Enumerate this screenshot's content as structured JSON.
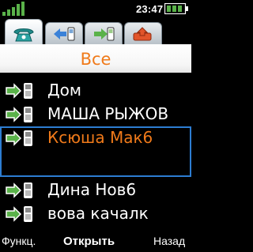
{
  "status": {
    "time": "23:47"
  },
  "tabs": [
    {
      "icon": "phone-icon",
      "active": true
    },
    {
      "icon": "arrow-left-phone-icon",
      "active": false
    },
    {
      "icon": "arrow-right-phone-icon",
      "active": false
    },
    {
      "icon": "missed-call-icon",
      "active": false
    }
  ],
  "header": {
    "title": "Все"
  },
  "contacts": [
    {
      "name": "Дом",
      "icon": "outgoing-call-icon",
      "selected": false
    },
    {
      "name": "МАША РЫЖОВ",
      "icon": "outgoing-call-icon",
      "selected": false
    },
    {
      "name": "Ксюша Мак6",
      "icon": "outgoing-call-icon",
      "selected": true
    },
    {
      "name": "Дина Нов6",
      "icon": "outgoing-call-icon",
      "selected": false
    },
    {
      "name": "вова качалк",
      "icon": "outgoing-call-icon",
      "selected": false
    }
  ],
  "softkeys": {
    "left": "Функц.",
    "middle": "Открыть",
    "right": "Назад"
  },
  "colors": {
    "accent": "#f07a1a",
    "selection_border": "#2d7dd2",
    "call_green": "#5ab24a"
  }
}
